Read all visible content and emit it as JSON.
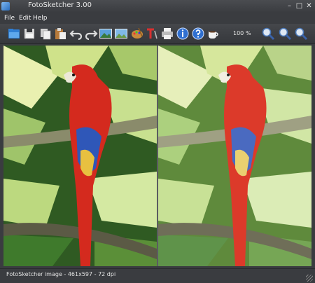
{
  "window": {
    "title": "FotoSketcher 3.00"
  },
  "menu": {
    "file": "File",
    "edit": "Edit",
    "help": "Help"
  },
  "toolbar": {
    "zoom_label": "100 %"
  },
  "status": {
    "text": "FotoSketcher image - 461x597 - 72 dpi"
  },
  "colors": {
    "frame": "#3a3c40",
    "toolbar": "#45474b",
    "parrot": "#d42a1e",
    "wing": "#2f57b8"
  },
  "icons": [
    "open-folder-icon",
    "save-icon",
    "copy-icon",
    "paste-icon",
    "undo-icon",
    "redo-icon",
    "original-image-icon",
    "result-image-icon",
    "palette-icon",
    "text-icon",
    "print-icon",
    "info-icon",
    "help-icon",
    "coffee-icon",
    "zoom-in-icon",
    "zoom-fit-icon",
    "zoom-out-icon"
  ]
}
